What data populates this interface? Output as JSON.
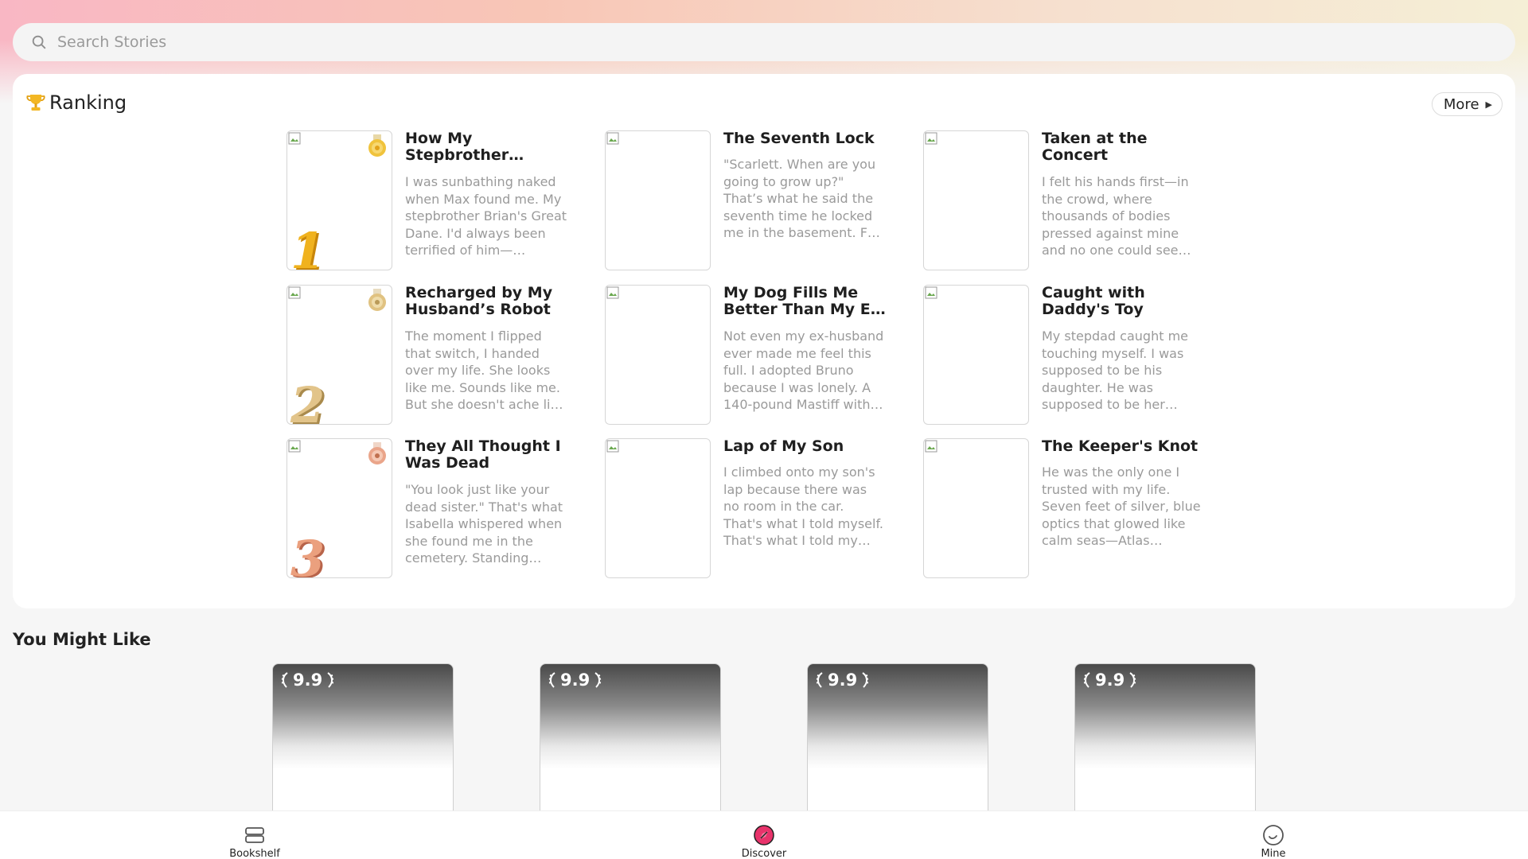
{
  "search": {
    "placeholder": "Search Stories",
    "icon": "search-icon"
  },
  "ranking": {
    "title": "Ranking",
    "icon": "trophy-icon",
    "more_label": "More",
    "items": [
      {
        "rank": "1",
        "medal": "gold",
        "title": "How My Stepbrother…",
        "desc": "I was sunbathing naked when Max found me. My stepbrother Brian's Great Dane. I'd always been terrified of him—…"
      },
      {
        "rank": "",
        "medal": "",
        "title": "The Seventh Lock",
        "desc": "\"Scarlett. When are you going to grow up?\" That’s what he said the seventh time he locked me in the basement. F…"
      },
      {
        "rank": "",
        "medal": "",
        "title": "Taken at the Concert",
        "desc": "I felt his hands first—in the crowd, where thousands of bodies pressed against mine and no one could see…"
      },
      {
        "rank": "2",
        "medal": "silver",
        "title": "Recharged by My Husband’s Robot",
        "desc": "The moment I flipped that switch, I handed over my life. She looks like me. Sounds like me. But she doesn't ache li…"
      },
      {
        "rank": "",
        "medal": "",
        "title": "My Dog Fills Me Better Than My E…",
        "desc": "Not even my ex-husband ever made me feel this full. I adopted Bruno because I was lonely. A 140-pound Mastiff with…"
      },
      {
        "rank": "",
        "medal": "",
        "title": "Caught with Daddy's Toy",
        "desc": "My stepdad caught me touching myself. I was supposed to be his daughter. He was supposed to be her…"
      },
      {
        "rank": "3",
        "medal": "bronze",
        "title": "They All Thought I Was Dead",
        "desc": "\"You look just like your dead sister.\" That's what Isabella whispered when she found me in the cemetery. Standing…"
      },
      {
        "rank": "",
        "medal": "",
        "title": "Lap of My Son",
        "desc": "I climbed onto my son's lap because there was no room in the car. That's what I told myself. That's what I told my…"
      },
      {
        "rank": "",
        "medal": "",
        "title": "The Keeper's Knot",
        "desc": "He was the only one I trusted with my life. Seven feet of silver, blue optics that glowed like calm seas—Atlas…"
      }
    ]
  },
  "you_might_like": {
    "title": "You Might Like",
    "cards": [
      {
        "score": "9.9"
      },
      {
        "score": "9.9"
      },
      {
        "score": "9.9"
      },
      {
        "score": "9.9"
      }
    ]
  },
  "bottom_nav": {
    "items": [
      {
        "label": "Bookshelf",
        "icon": "bookshelf-icon",
        "active": false
      },
      {
        "label": "Discover",
        "icon": "discover-icon",
        "active": true
      },
      {
        "label": "Mine",
        "icon": "mine-icon",
        "active": false
      }
    ],
    "accent": "#e8336b"
  },
  "colors": {
    "medal_gold": "#f0b21e",
    "medal_silver": "#e2c48a",
    "medal_bronze": "#eba07e"
  }
}
